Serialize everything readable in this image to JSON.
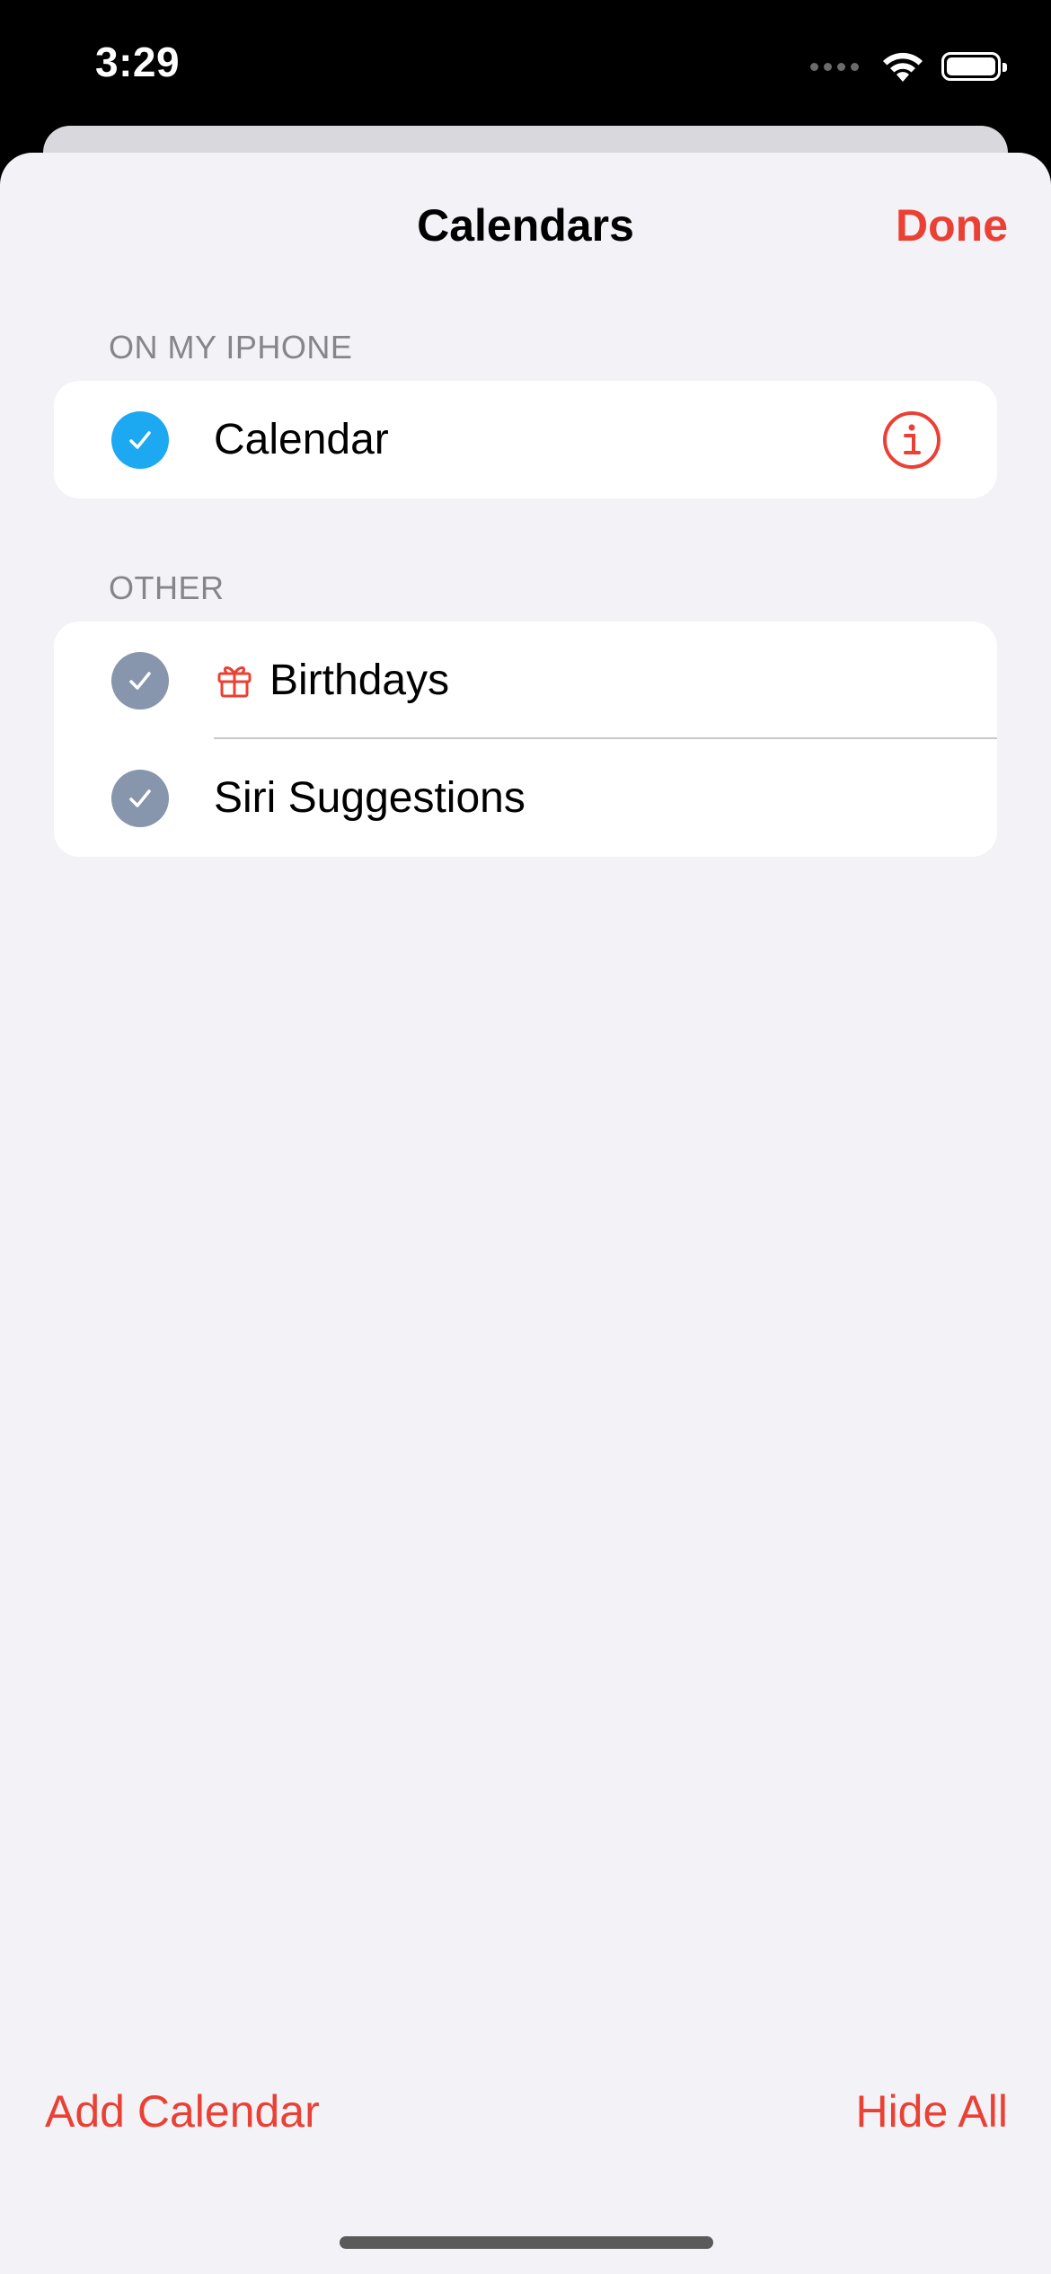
{
  "status_bar": {
    "time": "3:29",
    "icons": [
      "cellular-dots-icon",
      "wifi-icon",
      "battery-icon"
    ]
  },
  "nav": {
    "title": "Calendars",
    "done_label": "Done"
  },
  "sections": [
    {
      "header": "ON MY IPHONE",
      "items": [
        {
          "label": "Calendar",
          "checked": true,
          "check_color": "#1da9f2",
          "info_button": true
        }
      ]
    },
    {
      "header": "OTHER",
      "items": [
        {
          "label": "Birthdays",
          "checked": true,
          "check_color": "#8795ad",
          "icon": "gift-icon"
        },
        {
          "label": "Siri Suggestions",
          "checked": true,
          "check_color": "#8795ad"
        }
      ]
    }
  ],
  "footer": {
    "add_calendar_label": "Add Calendar",
    "hide_all_label": "Hide All"
  },
  "colors": {
    "accent": "#eb4034",
    "sheet_background": "#f2f2f7",
    "section_header": "#85858a"
  }
}
